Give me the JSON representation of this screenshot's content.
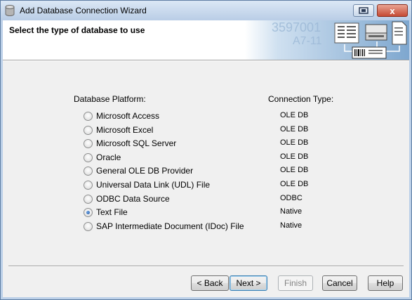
{
  "window": {
    "title": "Add Database Connection Wizard",
    "close_glyph": "x"
  },
  "header": {
    "title": "Select the type of database to use",
    "banner_text_1": "3597001",
    "banner_text_2": "A7-11"
  },
  "columns": {
    "platform_header": "Database Platform:",
    "type_header": "Connection Type:"
  },
  "platforms": [
    {
      "label": "Microsoft Access",
      "type": "OLE DB",
      "checked": false
    },
    {
      "label": "Microsoft Excel",
      "type": "OLE DB",
      "checked": false
    },
    {
      "label": "Microsoft SQL Server",
      "type": "OLE DB",
      "checked": false
    },
    {
      "label": "Oracle",
      "type": "OLE DB",
      "checked": false
    },
    {
      "label": "General OLE DB Provider",
      "type": "OLE DB",
      "checked": false
    },
    {
      "label": "Universal Data Link (UDL) File",
      "type": "OLE DB",
      "checked": false
    },
    {
      "label": "ODBC Data Source",
      "type": "ODBC",
      "checked": false
    },
    {
      "label": "Text File",
      "type": "Native",
      "checked": true
    },
    {
      "label": "SAP Intermediate Document (IDoc) File",
      "type": "Native",
      "checked": false
    }
  ],
  "buttons": {
    "back": "< Back",
    "next": "Next >",
    "finish": "Finish",
    "cancel": "Cancel",
    "help": "Help"
  }
}
